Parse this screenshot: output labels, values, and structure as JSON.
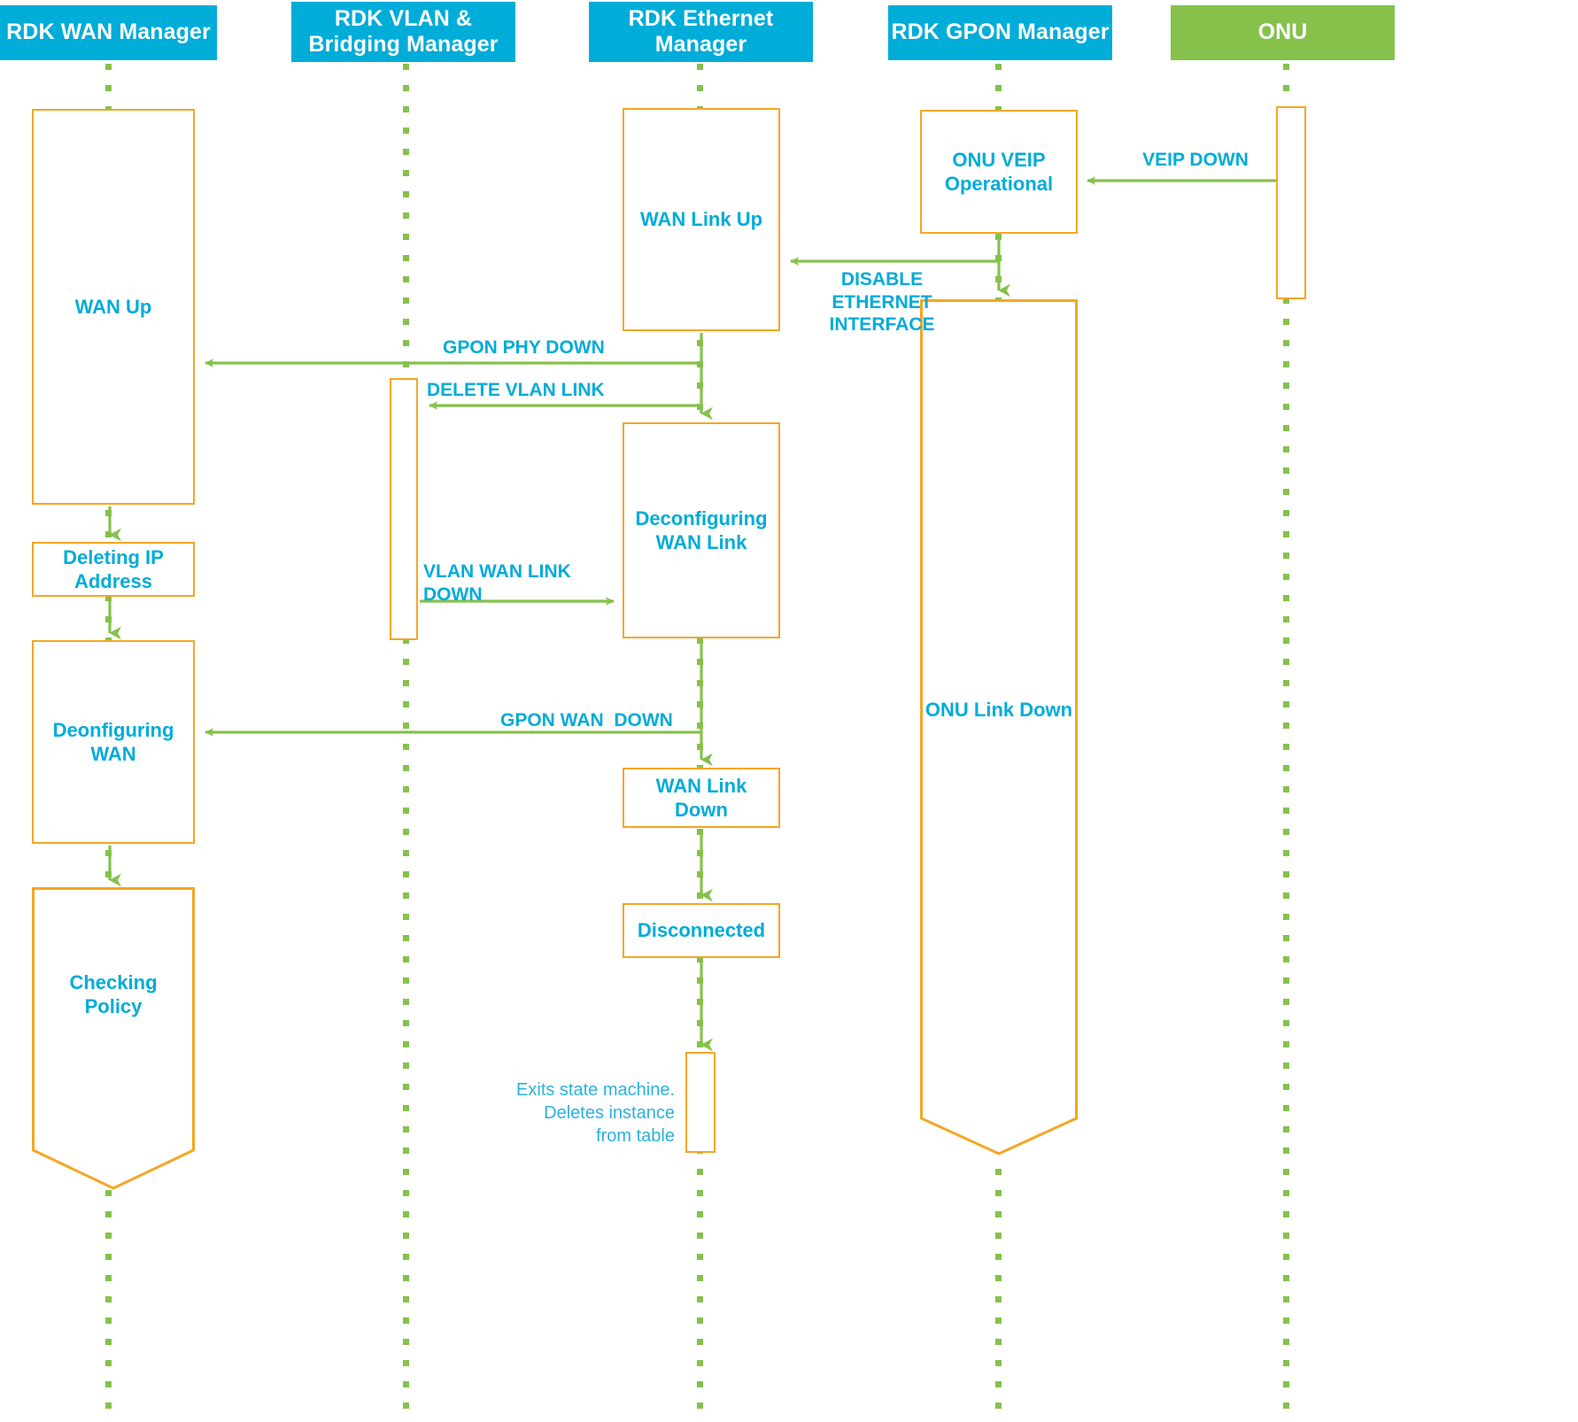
{
  "diagram": {
    "title": "RDK GPON WAN teardown sequence",
    "colors": {
      "lane_blue": "#00ACD8",
      "lane_green": "#85C14B",
      "box_border": "#F5A623",
      "arrow_green": "#85C14B",
      "text_blue": "#00ACD8"
    }
  },
  "lanes": [
    {
      "id": "wan",
      "label": "RDK WAN Manager",
      "kind": "blue"
    },
    {
      "id": "vlan",
      "label": "RDK VLAN &\nBridging Manager",
      "kind": "blue"
    },
    {
      "id": "eth",
      "label": "RDK Ethernet\nManager",
      "kind": "blue"
    },
    {
      "id": "gpon",
      "label": "RDK GPON Manager",
      "kind": "blue"
    },
    {
      "id": "onu",
      "label": "ONU",
      "kind": "green"
    }
  ],
  "states": {
    "wan_up": "WAN Up",
    "deleting_ip": "Deleting IP\nAddress",
    "deconfiguring_wan": "Deonfiguring\nWAN",
    "checking_policy": "Checking\nPolicy",
    "vlan_activation": "",
    "wan_link_up": "WAN Link Up",
    "deconfiguring_wan_link": "Deconfiguring\nWAN Link",
    "wan_link_down": "WAN Link\nDown",
    "disconnected": "Disconnected",
    "exit_activation": "",
    "onu_veip_operational": "ONU VEIP\nOperational",
    "onu_link_down": "ONU Link Down",
    "onu_activation": ""
  },
  "messages": {
    "veip_down": "VEIP DOWN",
    "disable_ethernet_interface": "DISABLE\nETHERNET\nINTERFACE",
    "gpon_phy_down": "GPON PHY DOWN",
    "delete_vlan_link": "DELETE VLAN LINK",
    "vlan_wan_link_down": "VLAN WAN LINK\nDOWN",
    "gpon_wan_down": "GPON WAN  DOWN"
  },
  "notes": {
    "exit_note": "Exits state machine.\nDeletes instance\nfrom table"
  }
}
